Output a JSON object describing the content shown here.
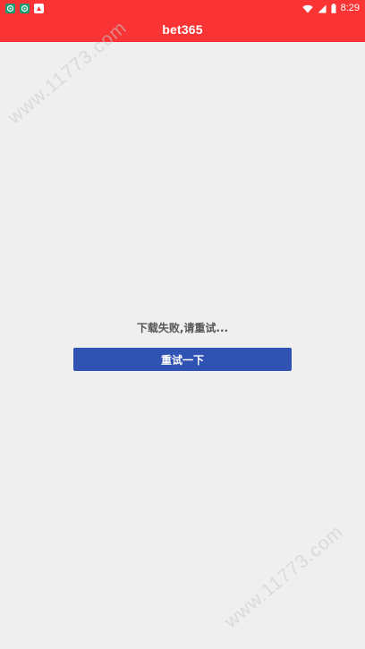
{
  "status_bar": {
    "time": "8:29",
    "notification_icons": [
      "android-icon",
      "android-icon",
      "app-icon"
    ],
    "system_icons": [
      "wifi-icon",
      "signal-icon",
      "battery-icon"
    ]
  },
  "app_bar": {
    "title": "bet365"
  },
  "content": {
    "message": "下载失败,请重试...",
    "retry_label": "重试一下"
  },
  "watermark": {
    "text": "www.11773.com"
  },
  "colors": {
    "header": "#fa3434",
    "background": "#efefef",
    "button": "#3052b3"
  }
}
